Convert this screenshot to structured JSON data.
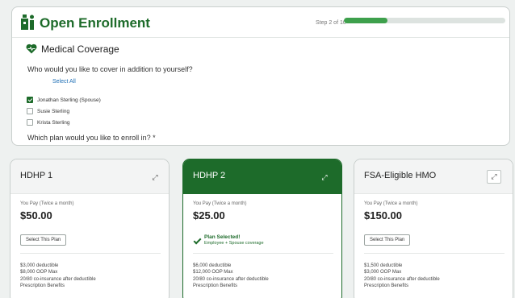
{
  "header": {
    "title": "Open Enrollment",
    "step_text": "Step 2 of 10",
    "progress_fraction": 0.27,
    "brand_color": "#1d6b2a"
  },
  "section": {
    "icon": "heart-icon",
    "title": "Medical Coverage",
    "question": "Who would you like to cover in addition to yourself?",
    "select_all": "Select All",
    "dependents": [
      {
        "label": "Jonathan Sterling (Spouse)",
        "checked": true
      },
      {
        "label": "Susie Sterling",
        "checked": false
      },
      {
        "label": "Krista Sterling",
        "checked": false
      }
    ],
    "plan_question": "Which plan would you like to enroll in? *"
  },
  "plans": [
    {
      "name": "HDHP 1",
      "pay_label": "You Pay (Twice a month)",
      "price": "$50.00",
      "button": "Select This Plan",
      "details": [
        "$3,000 deductible",
        "$8,000 OOP Max",
        "20/80 co-insurance after deductible",
        "Prescription Benefits"
      ]
    },
    {
      "name": "HDHP 2",
      "pay_label": "You Pay (Twice a month)",
      "price": "$25.00",
      "selected_title": "Plan Selected!",
      "selected_sub": "Employee + Spouse coverage",
      "details": [
        "$6,000 deductible",
        "$12,000 OOP Max",
        "20/80 co-insurance after deductible",
        "Prescription Benefits"
      ]
    },
    {
      "name": "FSA-Eligible HMO",
      "pay_label": "You Pay (Twice a month)",
      "price": "$150.00",
      "button": "Select This Plan",
      "details": [
        "$1,500 deductible",
        "$3,000 OOP Max",
        "20/80 co-insurance after deductible",
        "Prescription Benefits"
      ]
    }
  ]
}
